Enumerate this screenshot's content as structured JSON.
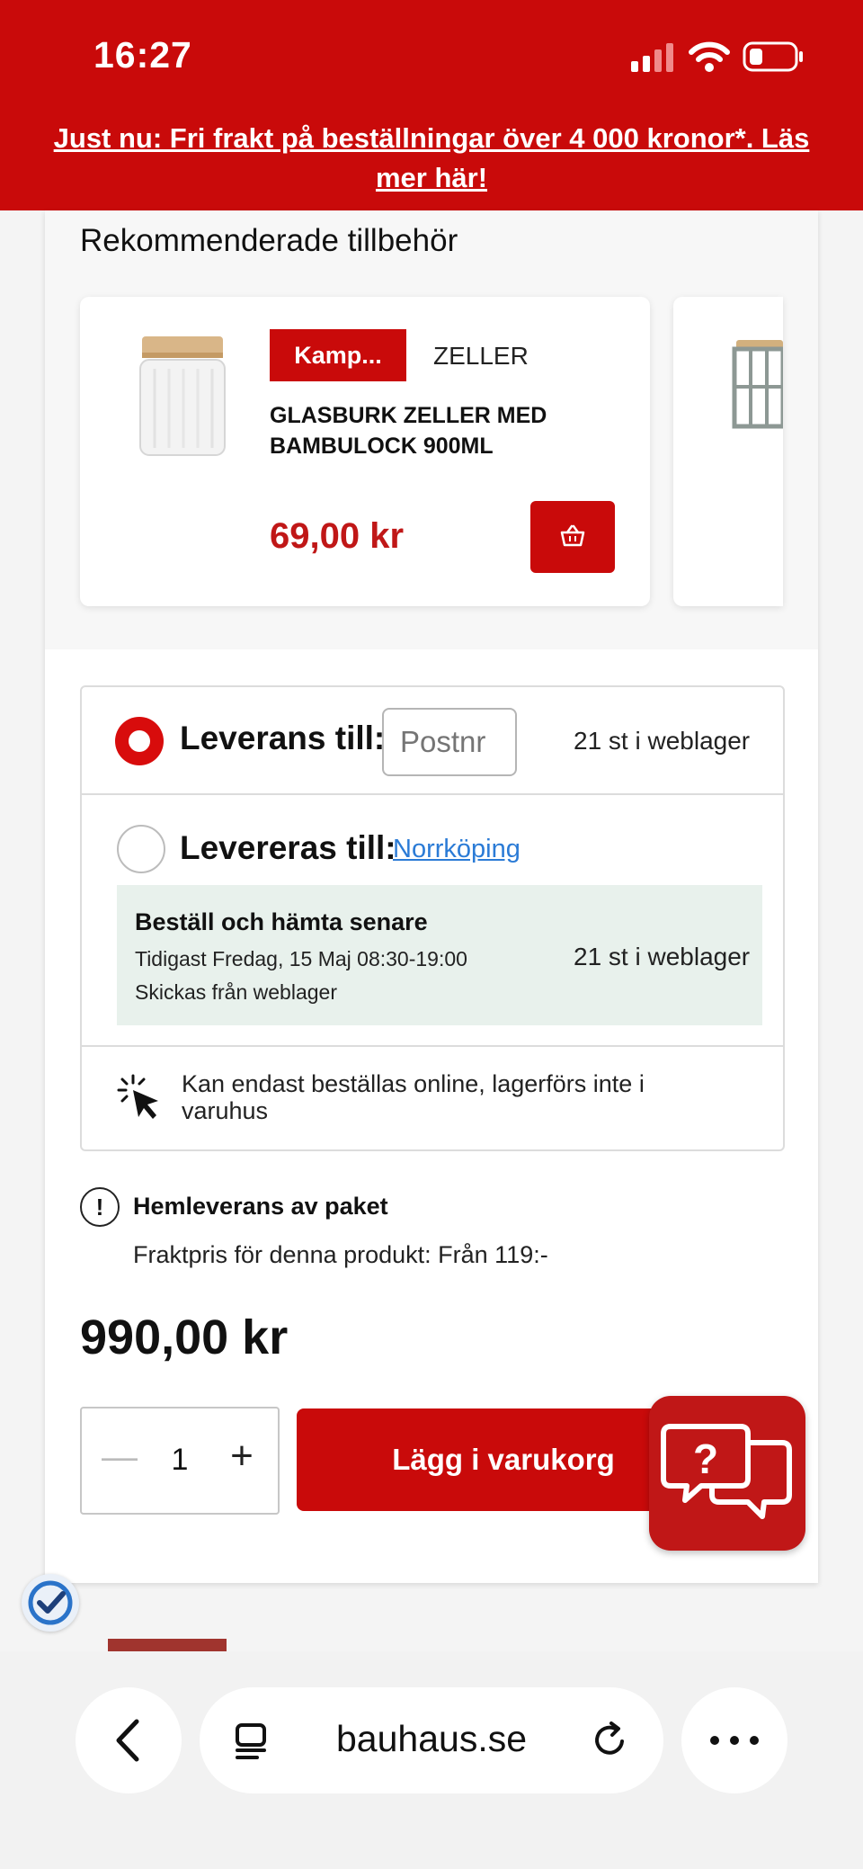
{
  "status_bar": {
    "time": "16:27"
  },
  "promo": {
    "text": "Just nu: Fri frakt på beställningar över 4 000 kronor*. Läs mer här!"
  },
  "accessories": {
    "title": "Rekommenderade tillbehör",
    "products": [
      {
        "badge": "Kamp...",
        "brand": "ZELLER",
        "name": "GLASBURK ZELLER MED BAMBULOCK 900ML",
        "price": "69,00 kr"
      }
    ]
  },
  "delivery": {
    "option1_label": "Leverans till:",
    "postcode_placeholder": "Postnr",
    "option1_stock": "21 st i weblager",
    "option2_label": "Levereras till:",
    "option2_city": "Norrköping",
    "pickup_title": "Beställ och hämta senare",
    "pickup_date": "Tidigast Fredag, 15 Maj 08:30-19:00",
    "pickup_ship": "Skickas från weblager",
    "option2_stock": "21 st i weblager",
    "online_note": "Kan endast beställas online, lagerförs inte i varuhus"
  },
  "shipping_info": {
    "title": "Hemleverans av paket",
    "price_text": "Fraktpris för denna produkt: Från 119:-"
  },
  "price": "990,00 kr",
  "quantity": {
    "value": "1",
    "minus": "—",
    "plus": "+"
  },
  "add_to_cart": "Lägg i varukorg",
  "browser": {
    "url": "bauhaus.se"
  },
  "colors": {
    "brand_red": "#c90a0a",
    "price_red": "#c01717",
    "link_blue": "#2b7bd6",
    "pickup_bg": "#e8f1ec"
  }
}
